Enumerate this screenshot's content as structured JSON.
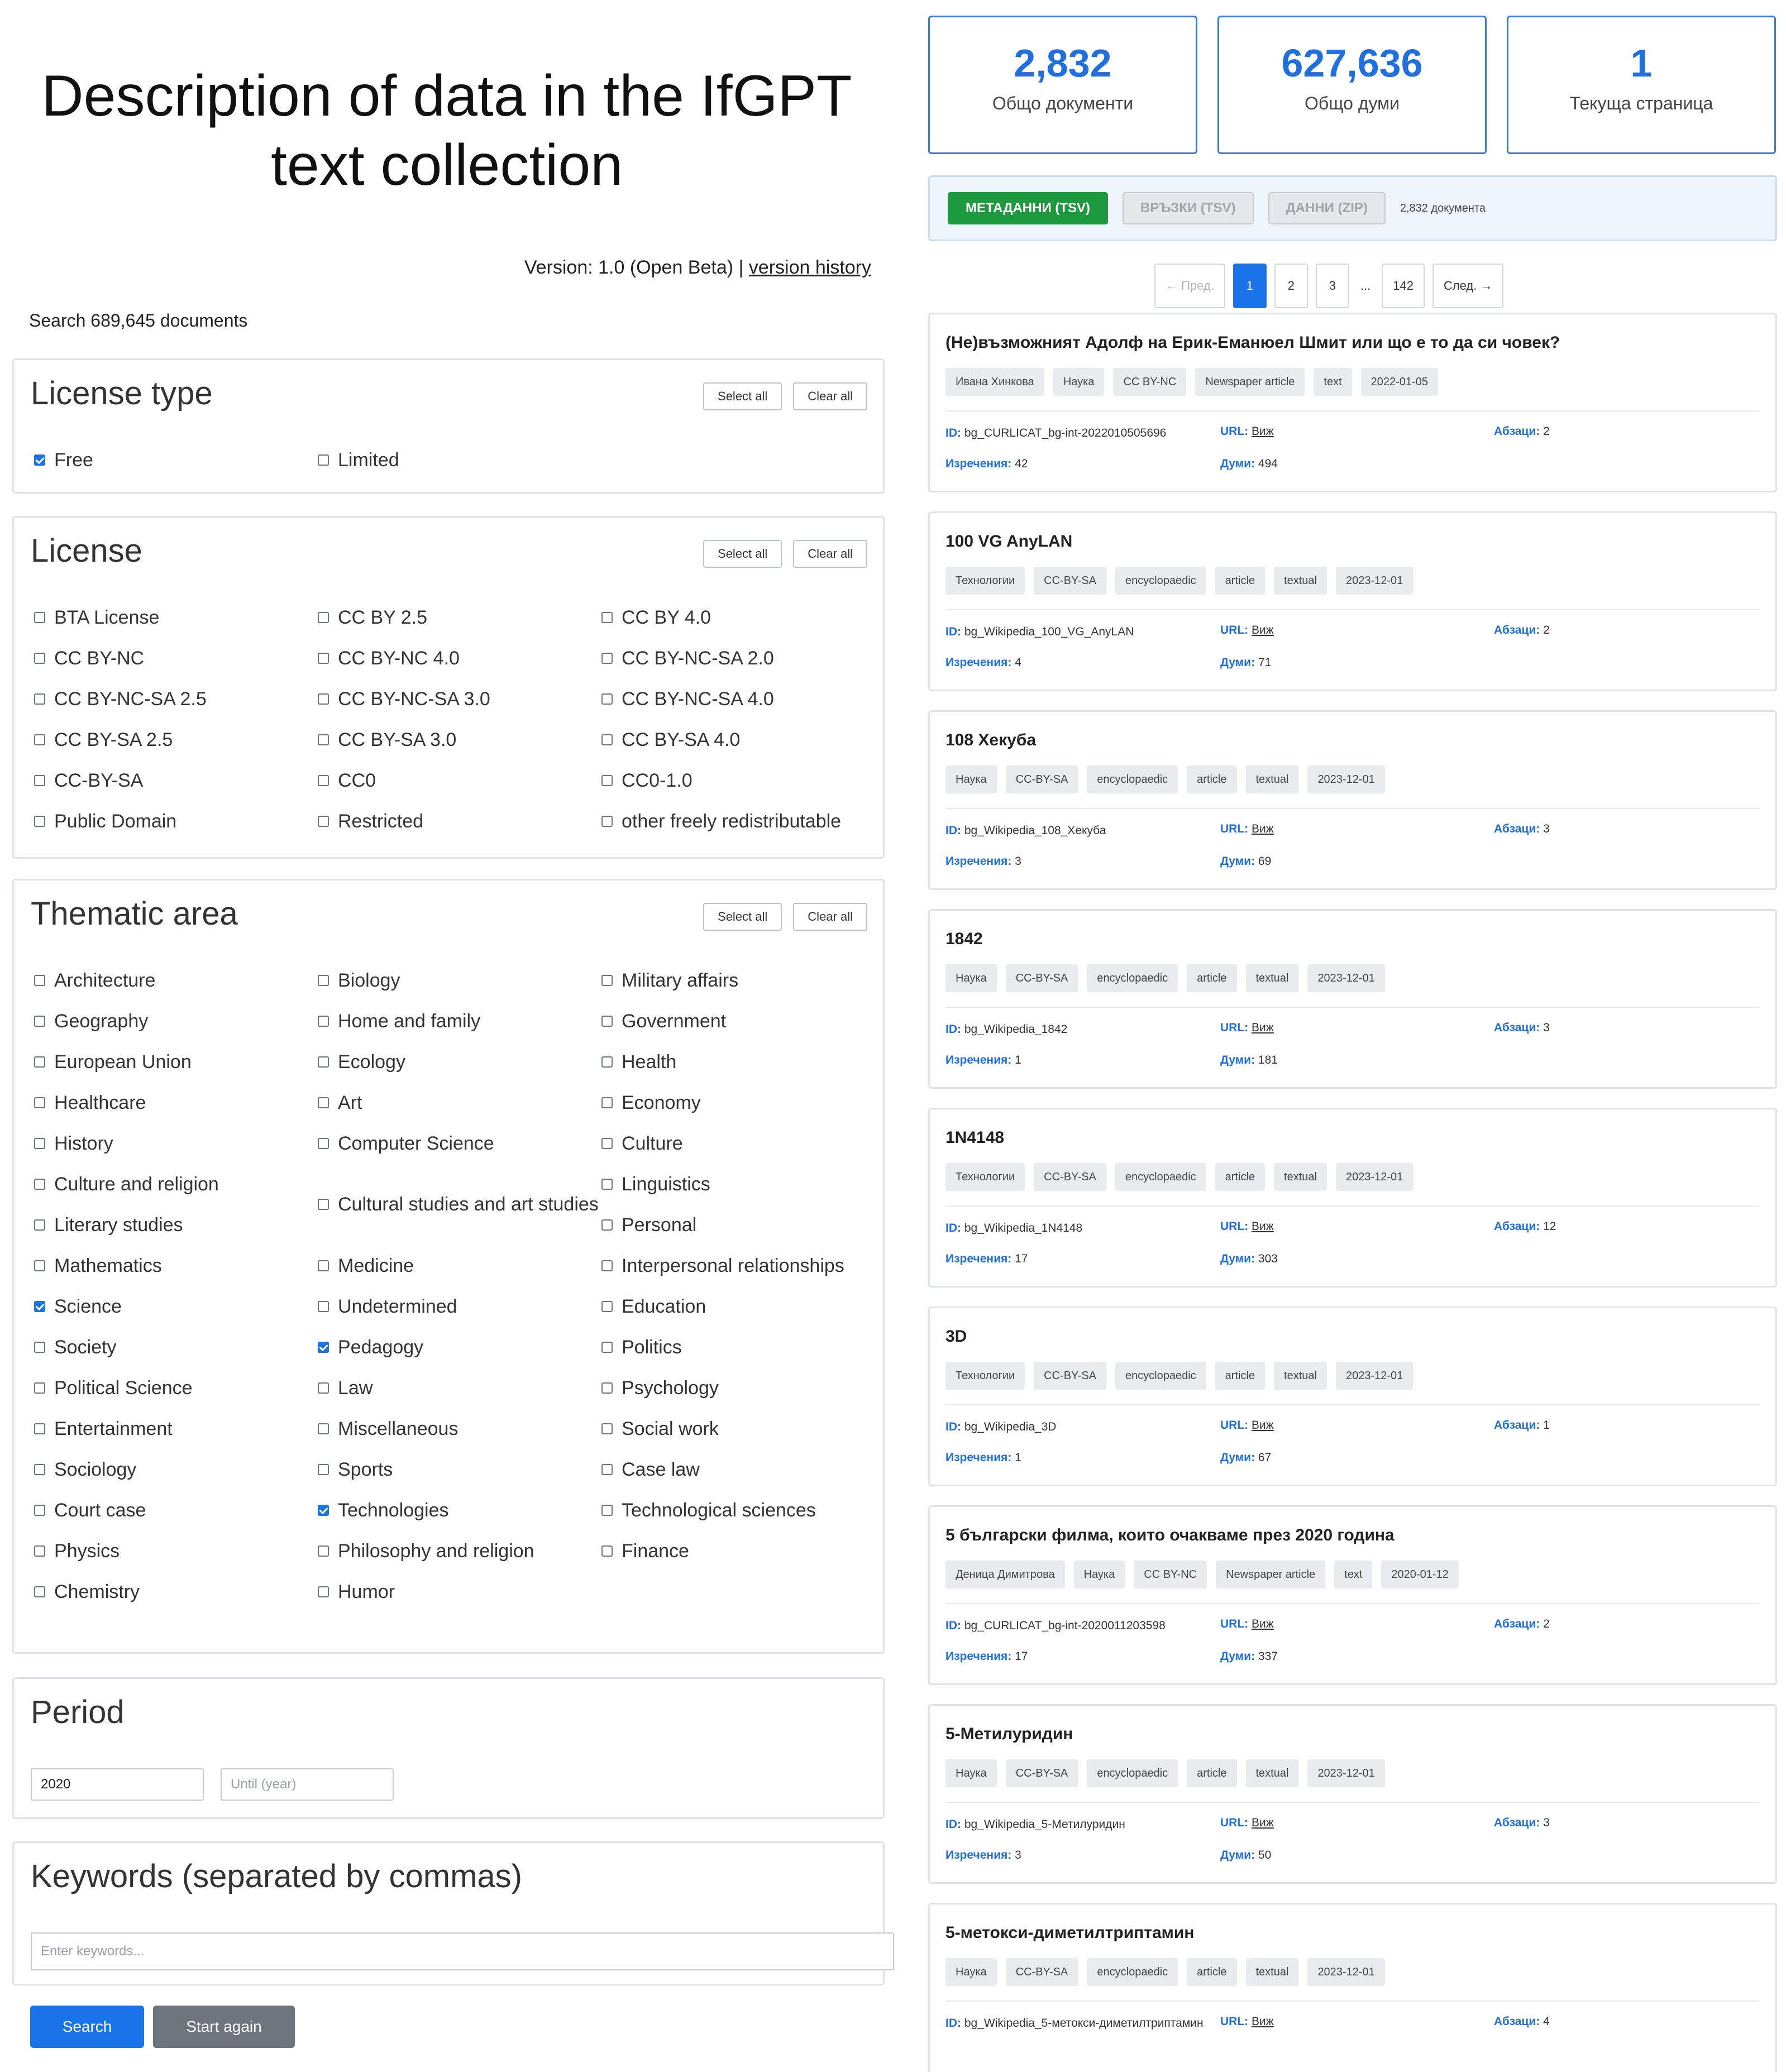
{
  "header": {
    "title": "Description of data in the IfGPT text collection",
    "version_text": "Version: 1.0 (Open Beta) |",
    "version_link": "version history",
    "search_count": "Search 689,645 documents"
  },
  "common": {
    "select_all": "Select all",
    "clear_all": "Clear all"
  },
  "license_type": {
    "title": "License type",
    "options": [
      {
        "label": "Free",
        "checked": true
      },
      {
        "label": "Limited",
        "checked": false
      }
    ]
  },
  "license": {
    "title": "License",
    "options": [
      {
        "label": "BTA License"
      },
      {
        "label": "CC BY 2.5"
      },
      {
        "label": "CC BY 4.0"
      },
      {
        "label": "CC BY-NC"
      },
      {
        "label": "CC BY-NC 4.0"
      },
      {
        "label": "CC BY-NC-SA 2.0"
      },
      {
        "label": "CC BY-NC-SA 2.5"
      },
      {
        "label": "CC BY-NC-SA 3.0"
      },
      {
        "label": "CC BY-NC-SA 4.0"
      },
      {
        "label": "CC BY-SA 2.5"
      },
      {
        "label": "CC BY-SA 3.0"
      },
      {
        "label": "CC BY-SA 4.0"
      },
      {
        "label": "CC-BY-SA"
      },
      {
        "label": "CC0"
      },
      {
        "label": "CC0-1.0"
      },
      {
        "label": "Public Domain"
      },
      {
        "label": "Restricted"
      },
      {
        "label": "other freely redistributable"
      }
    ]
  },
  "thematic": {
    "title": "Thematic area",
    "options": [
      {
        "label": "Architecture"
      },
      {
        "label": "Biology"
      },
      {
        "label": "Military affairs"
      },
      {
        "label": "Geography"
      },
      {
        "label": "Home and family"
      },
      {
        "label": "Government"
      },
      {
        "label": "European Union"
      },
      {
        "label": "Ecology"
      },
      {
        "label": "Health"
      },
      {
        "label": "Healthcare"
      },
      {
        "label": "Art"
      },
      {
        "label": "Economy"
      },
      {
        "label": "History"
      },
      {
        "label": "Computer Science"
      },
      {
        "label": "Culture"
      },
      {
        "label": "Culture and religion"
      },
      {
        "label": "Cultural studies and art studies",
        "tall": true
      },
      {
        "label": "Linguistics"
      },
      {
        "label": "Literary studies"
      },
      {
        "label": "Personal"
      },
      {
        "label": "Mathematics"
      },
      {
        "label": "Medicine"
      },
      {
        "label": "Interpersonal relationships"
      },
      {
        "label": "Science",
        "checked": true
      },
      {
        "label": "Undetermined"
      },
      {
        "label": "Education"
      },
      {
        "label": "Society"
      },
      {
        "label": "Pedagogy",
        "checked": true
      },
      {
        "label": "Politics"
      },
      {
        "label": "Political Science"
      },
      {
        "label": "Law"
      },
      {
        "label": "Psychology"
      },
      {
        "label": "Entertainment"
      },
      {
        "label": "Miscellaneous"
      },
      {
        "label": "Social work"
      },
      {
        "label": "Sociology"
      },
      {
        "label": "Sports"
      },
      {
        "label": "Case law"
      },
      {
        "label": "Court case"
      },
      {
        "label": "Technologies",
        "checked": true
      },
      {
        "label": "Technological sciences"
      },
      {
        "label": "Physics"
      },
      {
        "label": "Philosophy and religion"
      },
      {
        "label": "Finance"
      },
      {
        "label": "Chemistry"
      },
      {
        "label": "Humor"
      }
    ]
  },
  "period": {
    "title": "Period",
    "from_value": "2020",
    "until_placeholder": "Until (year)"
  },
  "keywords": {
    "title": "Keywords (separated by commas)",
    "placeholder": "Enter keywords..."
  },
  "actions": {
    "search": "Search",
    "reset": "Start again"
  },
  "colors": {
    "primary": "#1a73e8",
    "success": "#1e9a3e",
    "secondary": "#6c757d"
  },
  "stats": [
    {
      "value": "2,832",
      "label": "Общо документи"
    },
    {
      "value": "627,636",
      "label": "Общо думи"
    },
    {
      "value": "1",
      "label": "Текуща страница"
    }
  ],
  "downloads": {
    "buttons": [
      {
        "label": "МЕТАДАННИ (TSV)",
        "active": true
      },
      {
        "label": "ВРЪЗКИ (TSV)",
        "active": false
      },
      {
        "label": "ДАННИ (ZIP)",
        "active": false
      }
    ],
    "count": "2,832 документа"
  },
  "pagination": {
    "prev": "← Пред.",
    "pages": [
      "1",
      "2",
      "3"
    ],
    "ellipsis": "...",
    "last": "142",
    "next": "След. →",
    "current": "1"
  },
  "meta_labels": {
    "id": "ID:",
    "url": "URL:",
    "url_link": "Виж",
    "paragraphs": "Абзаци:",
    "sentences": "Изречения:",
    "words": "Думи:"
  },
  "results": [
    {
      "title": "(Не)възможният Адолф на Ерик-Еманюел Шмит или що е то да си човек?",
      "tags": [
        "Ивана Хинкова",
        "Наука",
        "CC BY-NC",
        "Newspaper article",
        "text",
        "2022-01-05"
      ],
      "id": "bg_CURLICAT_bg-int-2022010505696",
      "paragraphs": "2",
      "sentences": "42",
      "words": "494"
    },
    {
      "title": "100 VG AnyLAN",
      "tags": [
        "Технологии",
        "CC-BY-SA",
        "encyclopaedic",
        "article",
        "textual",
        "2023-12-01"
      ],
      "id": "bg_Wikipedia_100_VG_AnyLAN",
      "paragraphs": "2",
      "sentences": "4",
      "words": "71"
    },
    {
      "title": "108 Хекуба",
      "tags": [
        "Наука",
        "CC-BY-SA",
        "encyclopaedic",
        "article",
        "textual",
        "2023-12-01"
      ],
      "id": "bg_Wikipedia_108_Хекуба",
      "paragraphs": "3",
      "sentences": "3",
      "words": "69"
    },
    {
      "title": "1842",
      "tags": [
        "Наука",
        "CC-BY-SA",
        "encyclopaedic",
        "article",
        "textual",
        "2023-12-01"
      ],
      "id": "bg_Wikipedia_1842",
      "paragraphs": "3",
      "sentences": "1",
      "words": "181"
    },
    {
      "title": "1N4148",
      "tags": [
        "Технологии",
        "CC-BY-SA",
        "encyclopaedic",
        "article",
        "textual",
        "2023-12-01"
      ],
      "id": "bg_Wikipedia_1N4148",
      "paragraphs": "12",
      "sentences": "17",
      "words": "303"
    },
    {
      "title": "3D",
      "tags": [
        "Технологии",
        "CC-BY-SA",
        "encyclopaedic",
        "article",
        "textual",
        "2023-12-01"
      ],
      "id": "bg_Wikipedia_3D",
      "paragraphs": "1",
      "sentences": "1",
      "words": "67"
    },
    {
      "title": "5 български филма, които очакваме през 2020 година",
      "tags": [
        "Деница Димитрова",
        "Наука",
        "CC BY-NC",
        "Newspaper article",
        "text",
        "2020-01-12"
      ],
      "id": "bg_CURLICAT_bg-int-2020011203598",
      "paragraphs": "2",
      "sentences": "17",
      "words": "337"
    },
    {
      "title": "5-Метилуридин",
      "tags": [
        "Наука",
        "CC-BY-SA",
        "encyclopaedic",
        "article",
        "textual",
        "2023-12-01"
      ],
      "id": "bg_Wikipedia_5-Метилуридин",
      "paragraphs": "3",
      "sentences": "3",
      "words": "50"
    },
    {
      "title": "5-метокси-диметилтриптамин",
      "tags": [
        "Наука",
        "CC-BY-SA",
        "encyclopaedic",
        "article",
        "textual",
        "2023-12-01"
      ],
      "id": "bg_Wikipedia_5-метокси-диметилтриптамин",
      "paragraphs": "4"
    }
  ]
}
